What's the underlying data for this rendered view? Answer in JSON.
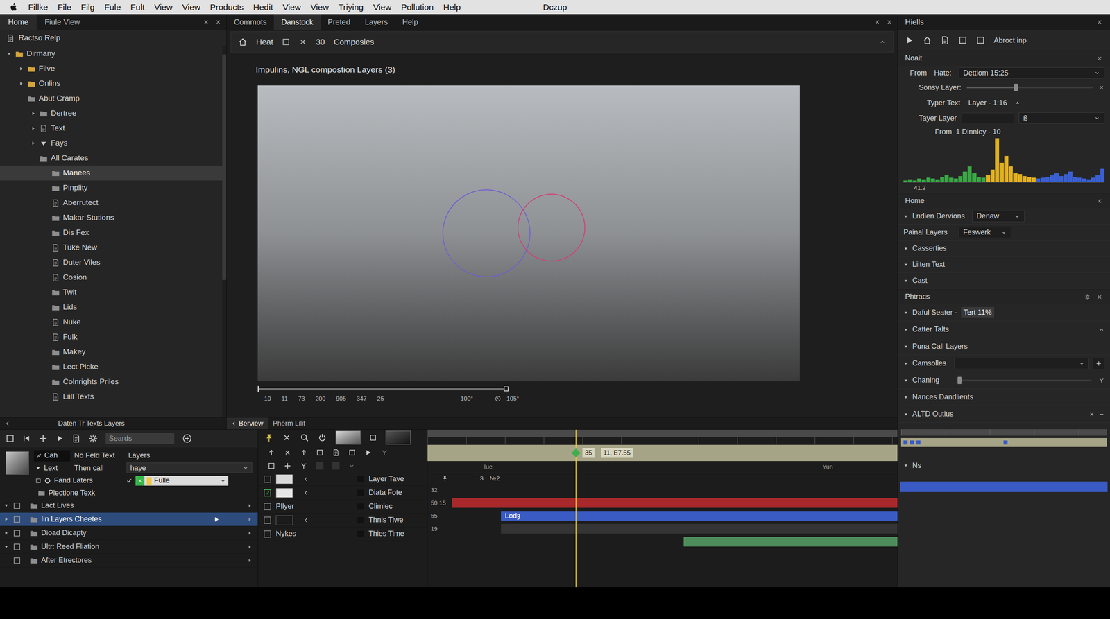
{
  "window": {
    "title": "Dczup"
  },
  "menu": [
    "Fillke",
    "File",
    "Filg",
    "Fule",
    "Fult",
    "View",
    "View",
    "Products",
    "Hedit",
    "View",
    "View",
    "Triying",
    "View",
    "Pollution",
    "Help"
  ],
  "left_panel": {
    "tabs": [
      {
        "label": "Home",
        "selected": true
      },
      {
        "label": "Fiule View",
        "selected": false
      }
    ],
    "header": "Ractso Relp",
    "tree": [
      {
        "label": "Dirmany",
        "depth": 0,
        "kind": "folder",
        "expander": "open",
        "selected": false
      },
      {
        "label": "Filve",
        "depth": 1,
        "kind": "folder",
        "expander": "closed",
        "selected": false
      },
      {
        "label": "Onlins",
        "depth": 1,
        "kind": "folder",
        "expander": "closed",
        "selected": false
      },
      {
        "label": "Abut Cramp",
        "depth": 1,
        "kind": "group",
        "expander": "none",
        "selected": false
      },
      {
        "label": "Dertree",
        "depth": 2,
        "kind": "group",
        "expander": "closed",
        "selected": false
      },
      {
        "label": "Text",
        "depth": 2,
        "kind": "file",
        "expander": "closed",
        "selected": false
      },
      {
        "label": "Fays",
        "depth": 2,
        "kind": "filter",
        "expander": "closed",
        "selected": false
      },
      {
        "label": "All Carates",
        "depth": 2,
        "kind": "group",
        "expander": "none",
        "selected": false
      },
      {
        "label": "Manees",
        "depth": 3,
        "kind": "group",
        "expander": "none",
        "selected": true
      },
      {
        "label": "Pinplity",
        "depth": 3,
        "kind": "group",
        "expander": "none",
        "selected": false
      },
      {
        "label": "Aberrutect",
        "depth": 3,
        "kind": "file",
        "expander": "none",
        "selected": false
      },
      {
        "label": "Makar Stutions",
        "depth": 3,
        "kind": "group",
        "expander": "none",
        "selected": false
      },
      {
        "label": "Dis Fex",
        "depth": 3,
        "kind": "group",
        "expander": "none",
        "selected": false
      },
      {
        "label": "Tuke New",
        "depth": 3,
        "kind": "file",
        "expander": "none",
        "selected": false
      },
      {
        "label": "Duter Viles",
        "depth": 3,
        "kind": "file",
        "expander": "none",
        "selected": false
      },
      {
        "label": "Cosion",
        "depth": 3,
        "kind": "file",
        "expander": "none",
        "selected": false
      },
      {
        "label": "Twit",
        "depth": 3,
        "kind": "group",
        "expander": "none",
        "selected": false
      },
      {
        "label": "Lids",
        "depth": 3,
        "kind": "group",
        "expander": "none",
        "selected": false
      },
      {
        "label": "Nuke",
        "depth": 3,
        "kind": "file",
        "expander": "none",
        "selected": false
      },
      {
        "label": "Fulk",
        "depth": 3,
        "kind": "file",
        "expander": "none",
        "selected": false
      },
      {
        "label": "Makey",
        "depth": 3,
        "kind": "group",
        "expander": "none",
        "selected": false
      },
      {
        "label": "Lect Picke",
        "depth": 3,
        "kind": "group",
        "expander": "none",
        "selected": false
      },
      {
        "label": "Colnrights Priles",
        "depth": 3,
        "kind": "group",
        "expander": "none",
        "selected": false
      },
      {
        "label": "Liill Texts",
        "depth": 3,
        "kind": "file",
        "expander": "none",
        "selected": false
      }
    ]
  },
  "editor": {
    "tabs": [
      {
        "label": "Commots",
        "selected": false
      },
      {
        "label": "Danstock",
        "selected": true
      },
      {
        "label": "Preted",
        "selected": false
      },
      {
        "label": "Layers",
        "selected": false
      },
      {
        "label": "Help",
        "selected": false
      }
    ],
    "toolbar": {
      "label": "Heat",
      "number": "30",
      "title": "Composies"
    },
    "title": "Impulins, NGL compostion Layers (3)",
    "ruler": {
      "ticks": [
        "10",
        "11",
        "73",
        "200",
        "905",
        "347",
        "25"
      ],
      "end_ticks": [
        "100°",
        "105°"
      ]
    }
  },
  "bottom_tabs": {
    "left": "Daten Tr Texts Layers",
    "tabs": [
      {
        "label": "Berview",
        "selected": true
      },
      {
        "label": "Pherm Lilit",
        "selected": false
      }
    ]
  },
  "timeline": {
    "search": {
      "placeholder": "Seards"
    },
    "props": {
      "cells": [
        "Cah",
        "No Feld Text",
        "Layers"
      ],
      "lext": {
        "label": "Lext",
        "expanded": true,
        "value": "Then call",
        "select": "haye"
      },
      "fand": {
        "label": "Fand Laters",
        "checked": true,
        "select": "Fulle"
      },
      "plection": "Plectione Texk"
    },
    "layers": [
      {
        "label": "Lact Lives",
        "expander": "open",
        "selected": false
      },
      {
        "label": "Iin Layers Cheetes",
        "expander": "closed",
        "selected": true
      },
      {
        "label": "Dioad Dicapty",
        "expander": "closed",
        "selected": false
      },
      {
        "label": "Ultr: Reed Fliation",
        "expander": "open",
        "selected": false
      },
      {
        "label": "After Etrectores",
        "expander": "none",
        "selected": false
      }
    ],
    "switches": [
      {
        "kind": "swatch",
        "checked": false,
        "color": "#d9d9d9",
        "label": "Layer Tave"
      },
      {
        "kind": "swatch",
        "checked": true,
        "color": "#e6e6e6",
        "label": "Diata Fote"
      },
      {
        "kind": "named",
        "checked": false,
        "name": "Pllyer",
        "label": "Climiec"
      },
      {
        "kind": "swatch",
        "checked": false,
        "color": "#1b1b1b",
        "label": "Thnis Tiwe"
      },
      {
        "kind": "named",
        "checked": false,
        "name": "Nykes",
        "label": "Thies Time"
      }
    ],
    "playhead": 0.315,
    "markers": [
      "35",
      "11, E7.55"
    ],
    "ruler": [
      "Iue",
      "Yun"
    ],
    "header": [
      "3",
      "№2"
    ],
    "tracks": [
      {
        "kind": "empty",
        "number": "32"
      },
      {
        "kind": "bar",
        "number": "50 15",
        "color": "#a8282b",
        "start": 0.0,
        "end": 1.0
      },
      {
        "kind": "bar",
        "number": "55",
        "color": "#3b5bc4",
        "start": 0.11,
        "end": 1.0,
        "label": "Lodȝ"
      },
      {
        "kind": "bar",
        "number": "19",
        "color": "#343434",
        "start": 0.11,
        "end": 1.0
      },
      {
        "kind": "bar",
        "number": "",
        "color": "#4e8c5c",
        "start": 0.52,
        "end": 1.0
      }
    ]
  },
  "right_panel": {
    "title": "Hiells",
    "toolbar_label": "Abroct inp",
    "noait": {
      "title": "Noait",
      "from": "From",
      "hate": "Hate:",
      "hate_value": "Dettiom 15:25",
      "sonsy": {
        "label": "Sonsy Layer:",
        "level": 0.39
      },
      "typer": {
        "label": "Typer Text",
        "value": "Layer · 1:16"
      },
      "tayer": {
        "label": "Tayer Layer",
        "value": "ß"
      },
      "from2": "From  1 Dinnley · 10",
      "histogram": {
        "label": "41.2",
        "series": [
          {
            "color": "#3aa845",
            "values": [
              2,
              3,
              2,
              4,
              3,
              5,
              4,
              3,
              6,
              8,
              5,
              4,
              7,
              12,
              18,
              10,
              6,
              5
            ]
          },
          {
            "color": "#e0b020",
            "values": [
              8,
              14,
              50,
              22,
              30,
              18,
              10,
              9,
              7,
              6,
              5
            ]
          },
          {
            "color": "#3a5fd0",
            "values": [
              4,
              5,
              6,
              8,
              10,
              7,
              9,
              12,
              6,
              5,
              4,
              3,
              5,
              8,
              15
            ]
          }
        ]
      }
    },
    "home": {
      "title": "Home",
      "rows": [
        {
          "kind": "dropdown",
          "label": "Lndien Dervions",
          "value": "Denaw"
        },
        {
          "kind": "field",
          "label": "Painal Layers",
          "value": "Feswerk"
        },
        {
          "kind": "group",
          "label": "Casserties"
        },
        {
          "kind": "group",
          "label": "Liiten Text"
        },
        {
          "kind": "group",
          "label": "Cast"
        }
      ]
    },
    "phtracs": {
      "title": "Phtracs",
      "rows": [
        {
          "kind": "value",
          "label": "Daful Seater ·",
          "value": "Tert 11%"
        },
        {
          "kind": "toggle",
          "label": "Catter Talts"
        },
        {
          "kind": "group",
          "label": "Puna Call Layers"
        },
        {
          "kind": "select-add",
          "label": "Camsolles"
        },
        {
          "kind": "slider",
          "label": "Chaning",
          "level": 0.0
        },
        {
          "kind": "group",
          "label": "Nances Dandlients"
        },
        {
          "kind": "closable",
          "label": "ALTD Outius"
        }
      ]
    },
    "ns": "Ns"
  }
}
